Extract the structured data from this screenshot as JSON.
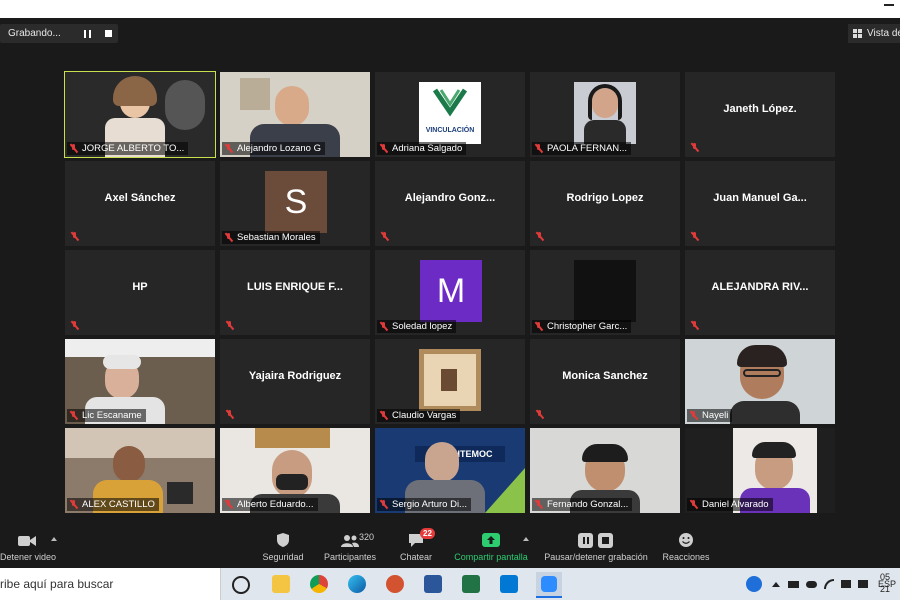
{
  "recording": {
    "status": "Grabando..."
  },
  "view_button": {
    "label": "Vista de"
  },
  "participants": [
    {
      "name": "JORGE ALBERTO TO...",
      "type": "video",
      "scene": "studio",
      "active": true
    },
    {
      "name": "Alejandro Lozano G",
      "type": "video",
      "scene": "man-office",
      "active": false
    },
    {
      "name": "Adriana Salgado",
      "type": "logo",
      "logo_text": "VINCULACIÓN"
    },
    {
      "name": "PAOLA FERNAN...",
      "type": "photo"
    },
    {
      "name": "Janeth López.",
      "type": "name"
    },
    {
      "name": "Axel Sánchez",
      "type": "name"
    },
    {
      "name": "Sebastian Morales",
      "type": "initial",
      "initial": "S",
      "color": "#6b4c3a"
    },
    {
      "name": "Alejandro  Gonz...",
      "type": "name"
    },
    {
      "name": "Rodrigo Lopez",
      "type": "name"
    },
    {
      "name": "Juan  Manuel  Ga...",
      "type": "name"
    },
    {
      "name": "HP",
      "type": "name"
    },
    {
      "name": "LUIS ENRIQUE F...",
      "type": "name"
    },
    {
      "name": "Soledad lopez",
      "type": "initial",
      "initial": "M",
      "color": "#6b2bc4"
    },
    {
      "name": "Christopher Garc...",
      "type": "blackbox"
    },
    {
      "name": "ALEJANDRA RIV...",
      "type": "name"
    },
    {
      "name": "Lic Escaname",
      "type": "video",
      "scene": "older-man"
    },
    {
      "name": "Yajaira Rodriguez",
      "type": "name"
    },
    {
      "name": "Claudio Vargas",
      "type": "photo-frame"
    },
    {
      "name": "Monica Sanchez",
      "type": "name"
    },
    {
      "name": "Nayeli",
      "type": "video",
      "scene": "kid-glasses"
    },
    {
      "name": "ALEX CASTILLO",
      "type": "video",
      "scene": "room"
    },
    {
      "name": "Alberto Eduardo...",
      "type": "video",
      "scene": "mask"
    },
    {
      "name": "Sergio Arturo Di...",
      "type": "video",
      "scene": "banner",
      "banner_text": "CUAUHTEMOC"
    },
    {
      "name": "Fernando Gonzal...",
      "type": "video",
      "scene": "plain"
    },
    {
      "name": "Daniel Alvarado",
      "type": "video",
      "scene": "purple"
    }
  ],
  "toolbar": {
    "video": "Detener video",
    "security": "Seguridad",
    "participants": "Participantes",
    "participants_count": "320",
    "chat": "Chatear",
    "chat_badge": "22",
    "share": "Compartir pantalla",
    "record": "Pausar/detener grabación",
    "reactions": "Reacciones"
  },
  "taskbar": {
    "search_placeholder": "ribe aquí para buscar",
    "language": "ESP",
    "clock_time": "05",
    "clock_date": "21"
  },
  "colors": {
    "active_speaker": "#c8e04b",
    "share_green": "#2ecc71",
    "muted_red": "#e03a3a",
    "badge_red": "#e53b3b"
  }
}
